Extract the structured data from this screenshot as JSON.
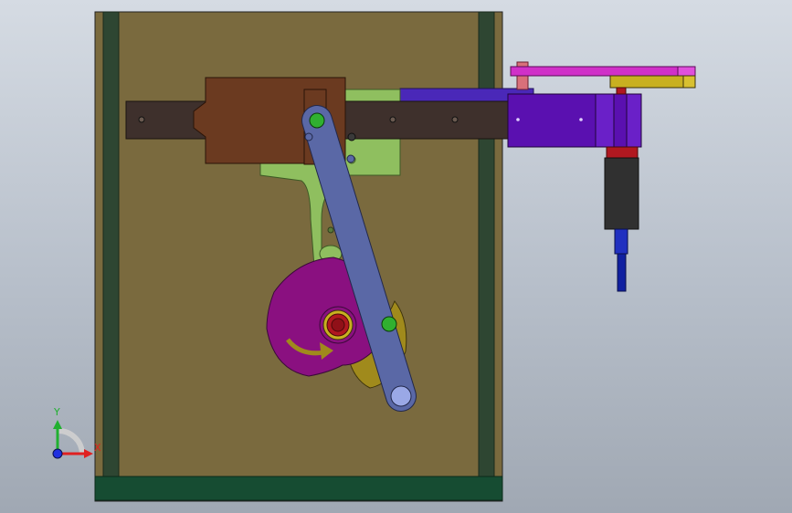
{
  "view": {
    "background_top": "#d5dbe3",
    "background_bottom": "#a0a8b3"
  },
  "axes_triad": {
    "x_label": "X",
    "y_label": "Y",
    "x_color": "#e02020",
    "y_color": "#20b030",
    "z_color": "#2030e0"
  },
  "colors": {
    "frame_panel": "#7a6a3e",
    "frame_rail": "#2e4632",
    "base_plate": "#164c32",
    "slide_bar": "#3e302c",
    "slider_block": "#6b3a20",
    "bracket": "#8fbf5f",
    "cam": "#8a1080",
    "cam_shadow": "#a08a1c",
    "link_arm": "#5a68a6",
    "actuator_body": "#5a10b0",
    "pink_arm": "#d030c8",
    "yellow_arm": "#c8b020",
    "motor_body": "#303030",
    "motor_shaft": "#1020a0",
    "pivot_green": "#30b030",
    "hub_red": "#b01820"
  },
  "model": {
    "parts": [
      "frame-panel",
      "left-rail",
      "right-rail",
      "base-plate",
      "slide-bar",
      "slider-block",
      "guide-bracket",
      "cam-plate",
      "link-arm",
      "actuator-block",
      "pink-arm",
      "yellow-arm",
      "motor",
      "motor-shaft"
    ]
  }
}
